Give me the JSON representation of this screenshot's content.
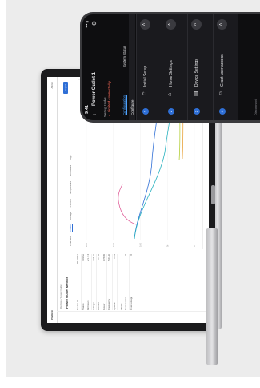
{
  "phone": {
    "time": "9:41",
    "signal": "••• ▮",
    "back_glyph": "‹",
    "device_name": "Power Outlet 1",
    "settings_glyph": "⚙",
    "subtitle": "Set up tasks",
    "warning": "Limited connectivity",
    "tabs": [
      "Configuration",
      "System Status"
    ],
    "configure_label": "Configure",
    "steps": [
      {
        "num": "1",
        "label": "Initial Setup",
        "icon": "wifi-icon"
      },
      {
        "num": "2",
        "label": "Home Settings",
        "icon": "home-icon"
      },
      {
        "num": "3",
        "label": "Device Settings",
        "icon": "device-icon"
      },
      {
        "num": "4",
        "label": "Grant user access",
        "icon": "user-icon"
      }
    ],
    "chevron_glyph": "˄",
    "footer": "Disconnect"
  },
  "laptop": {
    "brand": "Platform",
    "user": "Admin",
    "breadcrumb": "Devices / Power Outlet",
    "title": "Power Outlet Metrics",
    "actions": [
      "Export"
    ],
    "tabs": [
      "Overview",
      "Power",
      "Voltage",
      "Current",
      "Temperature",
      "Schedules",
      "Logs"
    ],
    "active_tab": 1,
    "details": [
      {
        "k": "Device ID",
        "v": "PO-0001"
      },
      {
        "k": "Status",
        "v": "Online"
      },
      {
        "k": "Firmware",
        "v": "v1.2.4"
      },
      {
        "k": "Voltage",
        "v": "230 V"
      },
      {
        "k": "Current",
        "v": "1.2 A"
      },
      {
        "k": "Power",
        "v": "276 W"
      },
      {
        "k": "Frequency",
        "v": "50 Hz"
      },
      {
        "k": "Uptime",
        "v": "14 d"
      }
    ],
    "section2": "Alerts",
    "alerts": [
      {
        "k": "Over-current",
        "v": "0"
      },
      {
        "k": "Over-voltage",
        "v": "0"
      }
    ],
    "y_ticks": [
      "0",
      "50",
      "100",
      "150",
      "200"
    ],
    "colors": {
      "blue": "#2f6fd6",
      "teal": "#2bb3c0",
      "pink": "#e0609a",
      "lime": "#b4cf3a",
      "orange": "#e8a23a"
    }
  }
}
